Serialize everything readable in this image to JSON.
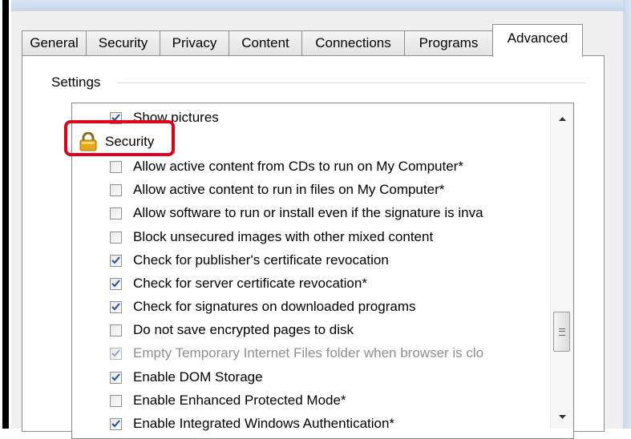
{
  "tabs": [
    {
      "label": "General"
    },
    {
      "label": "Security"
    },
    {
      "label": "Privacy"
    },
    {
      "label": "Content"
    },
    {
      "label": "Connections"
    },
    {
      "label": "Programs"
    },
    {
      "label": "Advanced",
      "active": true
    }
  ],
  "settings_label": "Settings",
  "list": {
    "top_item": {
      "label": "Show pictures",
      "checked": true
    },
    "group": {
      "label": "Security",
      "icon": "lock-icon",
      "highlighted": true
    },
    "items": [
      {
        "label": "Allow active content from CDs to run on My Computer*",
        "checked": false
      },
      {
        "label": "Allow active content to run in files on My Computer*",
        "checked": false
      },
      {
        "label": "Allow software to run or install even if the signature is inva",
        "checked": false
      },
      {
        "label": "Block unsecured images with other mixed content",
        "checked": false
      },
      {
        "label": "Check for publisher's certificate revocation",
        "checked": true
      },
      {
        "label": "Check for server certificate revocation*",
        "checked": true
      },
      {
        "label": "Check for signatures on downloaded programs",
        "checked": true
      },
      {
        "label": "Do not save encrypted pages to disk",
        "checked": false
      },
      {
        "label": "Empty Temporary Internet Files folder when browser is clo",
        "checked": true,
        "disabled": true
      },
      {
        "label": "Enable DOM Storage",
        "checked": true
      },
      {
        "label": "Enable Enhanced Protected Mode*",
        "checked": false
      },
      {
        "label": "Enable Integrated Windows Authentication*",
        "checked": true
      }
    ]
  },
  "colors": {
    "highlight": "#e4001b",
    "check": "#1f4f9a",
    "lock": "#e6a817"
  }
}
